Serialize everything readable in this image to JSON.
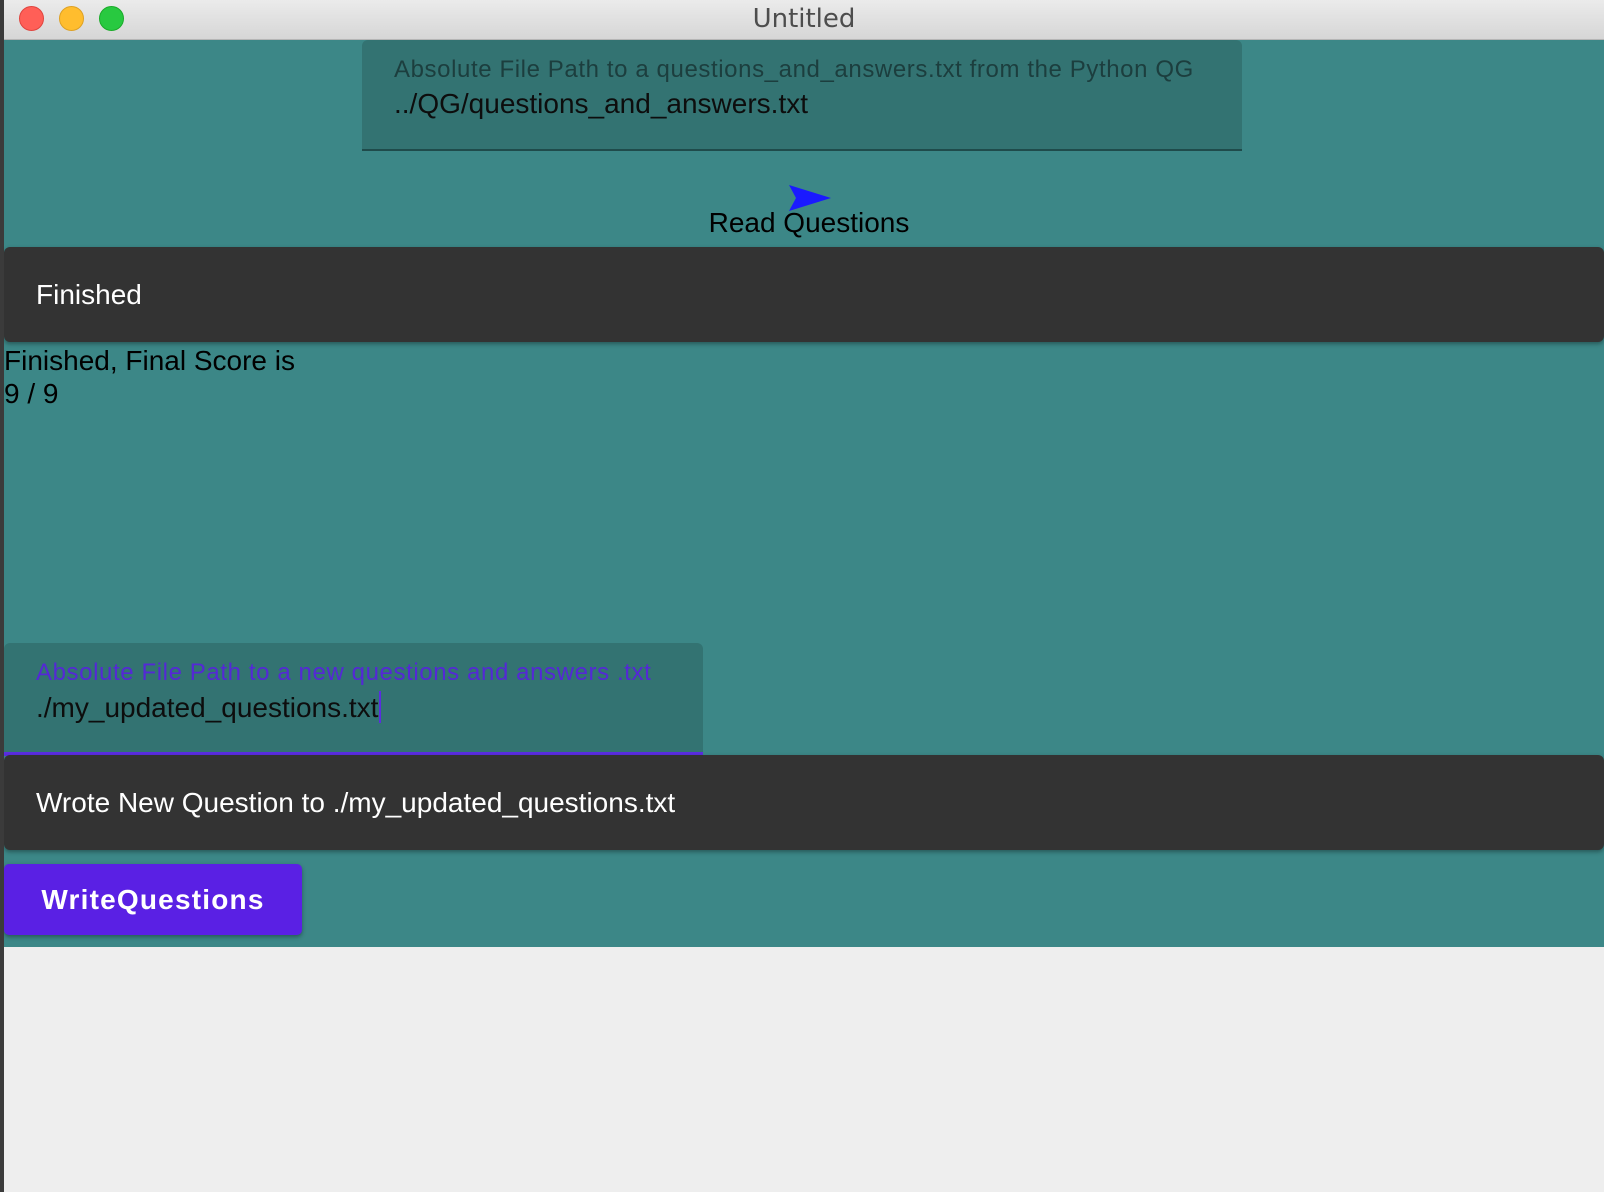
{
  "window": {
    "title": "Untitled"
  },
  "read_section": {
    "path_field": {
      "label": "Absolute File Path to a questions_and_answers.txt from the Python QG",
      "value": "../QG/questions_and_answers.txt"
    },
    "read_button_label": "Read Questions",
    "read_button_icon": "send-icon",
    "status_panel_text": "Finished"
  },
  "score": {
    "line1": "Finished, Final Score is",
    "line2": "9 / 9"
  },
  "write_section": {
    "path_field": {
      "label": "Absolute File Path to a new questions and answers .txt",
      "value": "./my_updated_questions.txt",
      "focused": true
    },
    "status_panel_text": "Wrote New Question to ./my_updated_questions.txt",
    "write_button_label": "WriteQuestions"
  },
  "colors": {
    "background": "#3c8787",
    "field_fill": "#337372",
    "panel": "#333333",
    "accent": "#5a20e4",
    "icon": "#1a1aff"
  }
}
